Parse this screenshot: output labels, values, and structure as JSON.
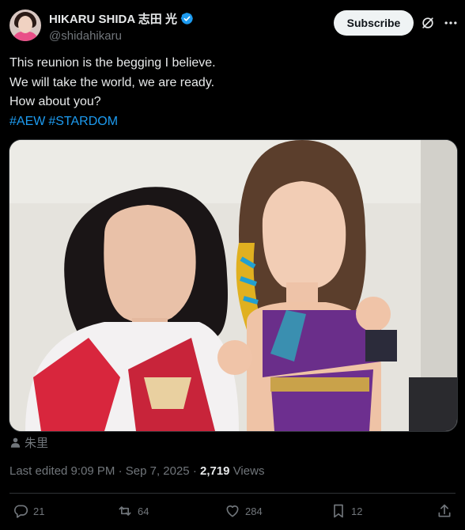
{
  "author": {
    "display_name": "HIKARU SHIDA 志田 光",
    "handle": "@shidahikaru",
    "verified": true
  },
  "subscribe_label": "Subscribe",
  "tweet": {
    "lines": [
      "This reunion is the begging I believe.",
      "We will take the world, we are ready.",
      "How about you?"
    ],
    "hashtags": [
      "#AEW",
      "#STARDOM"
    ]
  },
  "photo_tag": "朱里",
  "meta": {
    "edited": "Last edited 9:09 PM · Sep 7, 2025 · ",
    "views_count": "2,719",
    "views_label": " Views"
  },
  "actions": {
    "replies": "21",
    "reposts": "64",
    "likes": "284",
    "bookmarks": "12"
  },
  "colors": {
    "background": "#000000",
    "text": "#e7e9ea",
    "secondary": "#71767b",
    "link": "#1d9bf0",
    "verified": "#1d9bf0",
    "divider": "#2f3336"
  },
  "icons": [
    "verified-badge-icon",
    "grok-icon",
    "more-icon",
    "person-tag-icon",
    "reply-icon",
    "repost-icon",
    "like-icon",
    "bookmark-icon",
    "share-icon"
  ]
}
